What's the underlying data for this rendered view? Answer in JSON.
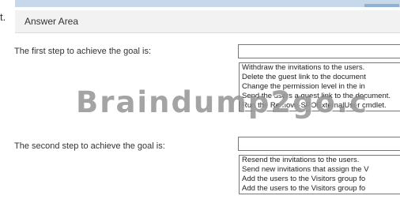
{
  "edge_char": "t.",
  "header": {
    "title": "Answer Area"
  },
  "steps": [
    {
      "prompt": "The first step to achieve the goal is:",
      "selected": "",
      "options": [
        "Withdraw the invitations to the users.",
        "Delete the guest link to the document",
        "Change the permission level in the in",
        "Send the users a guest link to the document.",
        "Run the Remove-SPOExternalUser cmdlet."
      ]
    },
    {
      "prompt": "The second step to achieve the goal is:",
      "selected": "",
      "options": [
        "Resend the invitations to the users.",
        "Send new invitations that assign the V",
        "Add the users to the Visitors group fo",
        "Add the users to the Visitors group fo"
      ]
    }
  ],
  "watermark": "Braindump2go.c"
}
